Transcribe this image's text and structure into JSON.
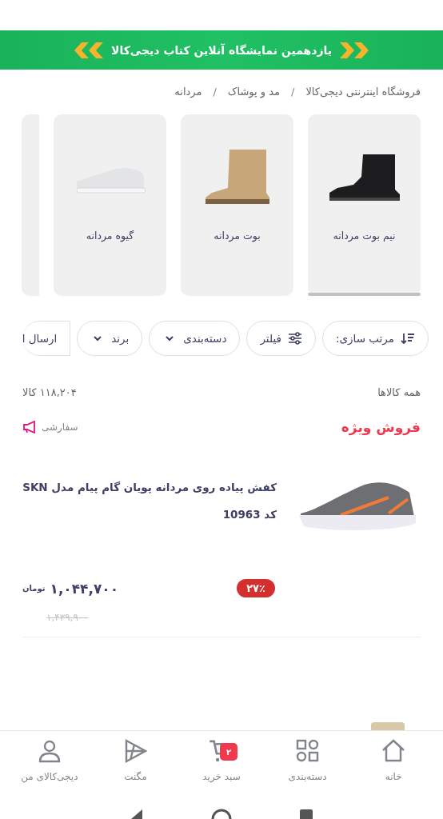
{
  "banner": {
    "text": "یازدهمین نمایشگاه آنلاین کتاب دیجی‌کالا"
  },
  "breadcrumb": [
    "فروشگاه اینترنتی دیجی‌کالا",
    "مد و پوشاک",
    "مردانه"
  ],
  "breadcrumb_separator": "/",
  "categories": [
    {
      "label": "نیم بوت مردانه",
      "kind": "ankle-boot"
    },
    {
      "label": "بوت مردانه",
      "kind": "boot"
    },
    {
      "label": "گیوه مردانه",
      "kind": "slip-on"
    },
    {
      "kind": "partial"
    }
  ],
  "chips": [
    {
      "label": "مرتب سازی:",
      "kind": "sort"
    },
    {
      "label": "فیلتر",
      "kind": "filter"
    },
    {
      "label": "دسته‌بندی",
      "kind": "dropdown"
    },
    {
      "label": "برند",
      "kind": "dropdown"
    },
    {
      "label": "ارسال ا",
      "kind": "toggle"
    }
  ],
  "listing": {
    "title": "همه کالاها",
    "count": "۱۱۸,۲۰۴ کالا"
  },
  "special_sale": {
    "label": "فروش ویژه",
    "promoted": "سفارشی"
  },
  "product": {
    "title": "کفش پیاده روی مردانه پویان گام پیام مدل SKN کد 10963",
    "discount": "۲۷٪",
    "price": "۱,۰۴۴,۷۰۰",
    "currency": "تومان",
    "old_price": "۱,۴۳۹,۹۰۰"
  },
  "bottom_nav": [
    {
      "label": "خانه",
      "kind": "home",
      "selected": false
    },
    {
      "label": "دسته‌بندی",
      "kind": "grid",
      "selected": false
    },
    {
      "label": "سبد خرید",
      "kind": "cart",
      "selected": false,
      "badge": "۲"
    },
    {
      "label": "مگنت",
      "kind": "play",
      "selected": false
    },
    {
      "label": "دیجی‌کالای من",
      "kind": "user",
      "selected": false
    }
  ]
}
